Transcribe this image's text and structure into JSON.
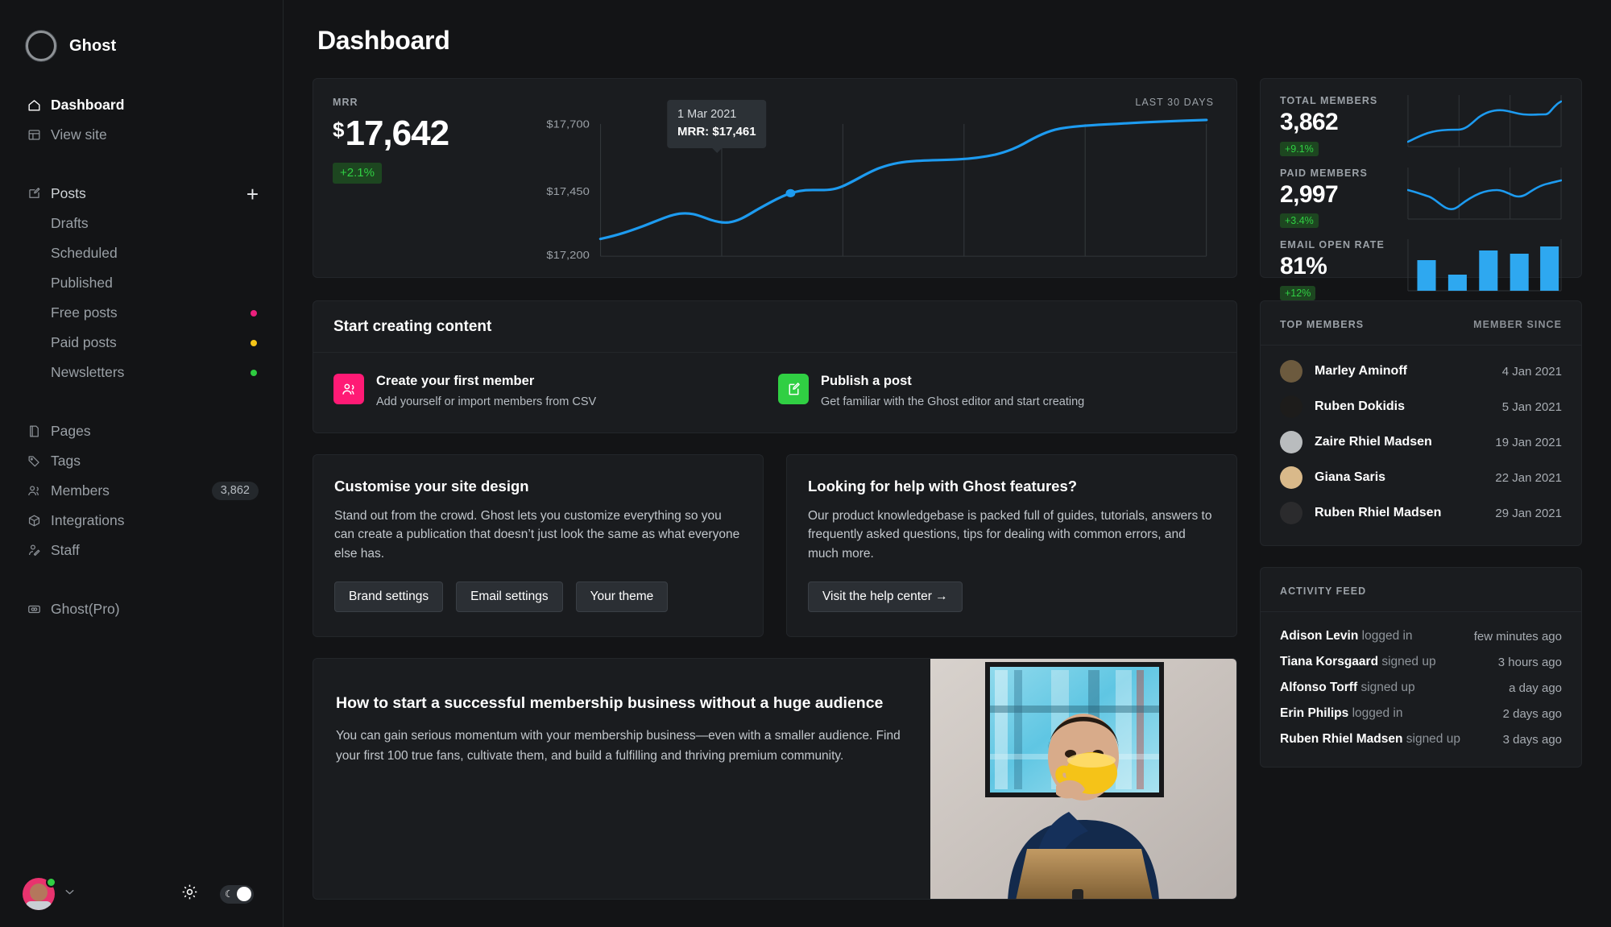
{
  "app": {
    "brand": "Ghost",
    "logo_icon": "ghost-logo-icon"
  },
  "sidebar": {
    "primary": [
      {
        "label": "Dashboard",
        "icon": "home-icon",
        "active": true
      },
      {
        "label": "View site",
        "icon": "layout-icon",
        "active": false
      }
    ],
    "posts": {
      "label": "Posts",
      "icon": "edit-icon",
      "add_icon": "plus-icon"
    },
    "post_sub": [
      {
        "label": "Drafts",
        "dot": ""
      },
      {
        "label": "Scheduled",
        "dot": ""
      },
      {
        "label": "Published",
        "dot": ""
      },
      {
        "label": "Free posts",
        "dot": "#ec1f7d"
      },
      {
        "label": "Paid posts",
        "dot": "#f5c518"
      },
      {
        "label": "Newsletters",
        "dot": "#2ecc40"
      }
    ],
    "secondary": [
      {
        "label": "Pages",
        "icon": "pages-icon",
        "pill": ""
      },
      {
        "label": "Tags",
        "icon": "tag-icon",
        "pill": ""
      },
      {
        "label": "Members",
        "icon": "members-icon",
        "pill": "3,862"
      },
      {
        "label": "Integrations",
        "icon": "box-icon",
        "pill": ""
      },
      {
        "label": "Staff",
        "icon": "staff-icon",
        "pill": ""
      }
    ],
    "tertiary": [
      {
        "label": "Ghost(Pro)",
        "icon": "ghost-pro-icon"
      }
    ],
    "footer": {
      "avatar_name": "user-avatar",
      "chevron_icon": "chevron-down-icon",
      "settings_icon": "gear-icon",
      "theme_toggle_icon": "moon-icon"
    }
  },
  "header": {
    "title": "Dashboard"
  },
  "mrr": {
    "kicker": "MRR",
    "currency": "$",
    "value": "17,642",
    "change": "+2.1%",
    "range_label": "LAST 30 DAYS",
    "tooltip": {
      "date": "1 Mar 2021",
      "line": "MRR: $17,461"
    }
  },
  "metrics": [
    {
      "kicker": "TOTAL MEMBERS",
      "value": "3,862",
      "change": "+9.1%",
      "spark": "line"
    },
    {
      "kicker": "PAID MEMBERS",
      "value": "2,997",
      "change": "+3.4%",
      "spark": "line"
    },
    {
      "kicker": "EMAIL OPEN RATE",
      "value": "81%",
      "change": "+12%",
      "spark": "bar"
    }
  ],
  "create": {
    "title": "Start creating content",
    "items": [
      {
        "icon": "members-add-icon",
        "color": "#ff1a75",
        "title": "Create your first member",
        "subtitle": "Add yourself or import members from CSV"
      },
      {
        "icon": "post-edit-icon",
        "color": "#30cf43",
        "title": "Publish a post",
        "subtitle": "Get familiar with the Ghost editor and start creating"
      }
    ]
  },
  "design_card": {
    "title": "Customise your site design",
    "body": "Stand out from the crowd. Ghost lets you customize everything so you can create a publication that doesn’t just look the same as what everyone else has.",
    "buttons": [
      "Brand settings",
      "Email settings",
      "Your theme"
    ]
  },
  "help_card": {
    "title": "Looking for help with Ghost features?",
    "body": "Our product knowledgebase is packed full of guides, tutorials, answers to frequently asked questions, tips for dealing with common errors, and much more.",
    "button": "Visit the help center →"
  },
  "article": {
    "title": "How to start a successful membership business without a huge audience",
    "body": "You can gain serious momentum with your membership business—even with a smaller audience. Find your first 100 true fans, cultivate them, and build a fulfilling and thriving premium community.",
    "image_alt": "man-drinking-coffee-at-laptop-photo"
  },
  "top_members": {
    "kicker": "TOP MEMBERS",
    "kicker_right": "MEMBER SINCE",
    "rows": [
      {
        "name": "Marley Aminoff",
        "date": "4 Jan 2021",
        "avatar": "#6c5a3e"
      },
      {
        "name": "Ruben Dokidis",
        "date": "5 Jan 2021",
        "avatar": "#1d1c1b"
      },
      {
        "name": "Zaire Rhiel Madsen",
        "date": "19 Jan 2021",
        "avatar": "#b9bcbe"
      },
      {
        "name": "Giana Saris",
        "date": "22 Jan 2021",
        "avatar": "#d9b98a"
      },
      {
        "name": "Ruben Rhiel Madsen",
        "date": "29 Jan 2021",
        "avatar": "#2b2b2d"
      }
    ]
  },
  "activity_feed": {
    "kicker": "ACTIVITY FEED",
    "rows": [
      {
        "name": "Adison Levin",
        "action": "logged in",
        "time": "few minutes ago"
      },
      {
        "name": "Tiana Korsgaard",
        "action": "signed up",
        "time": "3 hours ago"
      },
      {
        "name": "Alfonso Torff",
        "action": "signed up",
        "time": "a day ago"
      },
      {
        "name": "Erin Philips",
        "action": "logged in",
        "time": "2 days ago"
      },
      {
        "name": "Ruben Rhiel Madsen",
        "action": "signed up",
        "time": "3 days ago"
      }
    ]
  },
  "chart_data": [
    {
      "type": "line",
      "title": "MRR",
      "ylabel": "",
      "xlabel": "",
      "ytick_labels": [
        "$17,700",
        "$17,450",
        "$17,200"
      ],
      "ylim": [
        17200,
        17700
      ],
      "grid": true,
      "accent_color": "#1d9bf0",
      "annotation": {
        "x_label": "1 Mar 2021",
        "value": 17461,
        "text": "MRR: $17,461"
      },
      "x": [
        0,
        1,
        2,
        3,
        4,
        5,
        6,
        7,
        8,
        9,
        10,
        11,
        12,
        13,
        14,
        15,
        16,
        17,
        18,
        19,
        20,
        21,
        22,
        23,
        24,
        25,
        26,
        27,
        28,
        29
      ],
      "values": [
        17258,
        17266,
        17276,
        17288,
        17300,
        17310,
        17316,
        17314,
        17308,
        17304,
        17309,
        17320,
        17334,
        17348,
        17360,
        17366,
        17368,
        17380,
        17398,
        17416,
        17432,
        17444,
        17452,
        17461,
        17472,
        17486,
        17500,
        17520,
        17560,
        17612
      ]
    },
    {
      "type": "line",
      "title": "TOTAL MEMBERS",
      "grid": true,
      "accent_color": "#1d9bf0",
      "values": [
        10,
        18,
        27,
        34,
        38,
        40,
        41,
        42,
        56,
        70,
        76,
        78,
        76,
        73,
        72,
        74,
        76,
        77,
        78,
        79,
        78,
        74,
        82,
        92,
        96
      ]
    },
    {
      "type": "line",
      "title": "PAID MEMBERS",
      "grid": true,
      "accent_color": "#1d9bf0",
      "values": [
        62,
        58,
        54,
        50,
        48,
        40,
        28,
        22,
        26,
        34,
        42,
        50,
        58,
        64,
        66,
        62,
        54,
        48,
        46,
        52,
        62,
        72,
        78,
        82,
        84
      ]
    },
    {
      "type": "bar",
      "title": "EMAIL OPEN RATE",
      "grid": true,
      "accent_color": "#2ea8f0",
      "categories": [
        "1",
        "2",
        "3",
        "4",
        "5"
      ],
      "values": [
        60,
        32,
        78,
        72,
        88
      ],
      "ylim": [
        0,
        100
      ]
    }
  ]
}
